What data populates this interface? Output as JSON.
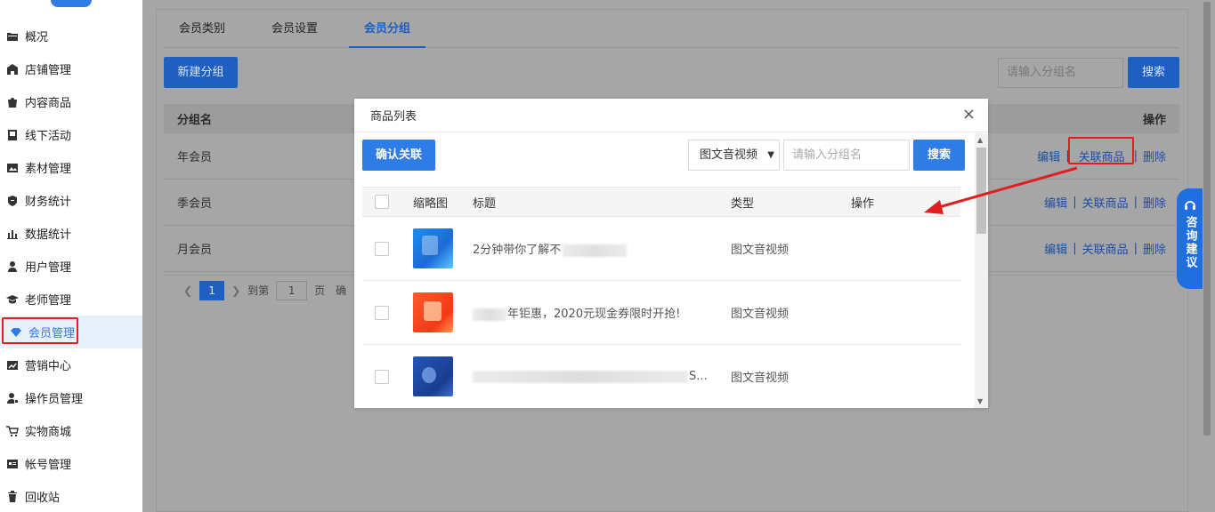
{
  "sidebar": {
    "items": [
      {
        "label": "概况",
        "icon": "folder-icon"
      },
      {
        "label": "店铺管理",
        "icon": "store-icon"
      },
      {
        "label": "内容商品",
        "icon": "bag-icon"
      },
      {
        "label": "线下活动",
        "icon": "flag-icon"
      },
      {
        "label": "素材管理",
        "icon": "image-icon"
      },
      {
        "label": "财务统计",
        "icon": "finance-icon"
      },
      {
        "label": "数据统计",
        "icon": "bar-chart-icon"
      },
      {
        "label": "用户管理",
        "icon": "user-icon"
      },
      {
        "label": "老师管理",
        "icon": "graduation-cap-icon"
      },
      {
        "label": "会员管理",
        "icon": "diamond-icon"
      },
      {
        "label": "营销中心",
        "icon": "trend-icon"
      },
      {
        "label": "操作员管理",
        "icon": "operator-icon"
      },
      {
        "label": "实物商城",
        "icon": "cart-icon"
      },
      {
        "label": "帐号管理",
        "icon": "id-card-icon"
      },
      {
        "label": "回收站",
        "icon": "trash-icon"
      }
    ]
  },
  "tabs": [
    "会员类别",
    "会员设置",
    "会员分组"
  ],
  "toolbar": {
    "new_group": "新建分组",
    "search_placeholder": "请输入分组名",
    "search": "搜索"
  },
  "table": {
    "header_name": "分组名",
    "header_ops": "操作",
    "rows": [
      {
        "name": "年会员"
      },
      {
        "name": "季会员"
      },
      {
        "name": "月会员"
      }
    ],
    "op_edit": "编辑",
    "op_link": "关联商品",
    "op_delete": "删除",
    "sep": "|"
  },
  "pager": {
    "current": "1",
    "goto_label": "到第",
    "goto_value": "1",
    "page_label": "页",
    "trailing": "确"
  },
  "consult": {
    "label": "咨询建议"
  },
  "modal": {
    "title": "商品列表",
    "close": "×",
    "confirm": "确认关联",
    "select_value": "图文音视频",
    "input_placeholder": "请输入分组名",
    "search": "搜索",
    "headers": {
      "thumb": "缩略图",
      "title": "标题",
      "type": "类型",
      "ops": "操作"
    },
    "rows": [
      {
        "title": "2分钟带你了解不",
        "type": "图文音视频"
      },
      {
        "title": "年钜惠，2020元现金券限时开抢!",
        "type": "图文音视频"
      },
      {
        "title": "S...",
        "type": "图文音视频"
      }
    ]
  },
  "colors": {
    "primary": "#2f7ce6",
    "highlight": "#e02020"
  }
}
